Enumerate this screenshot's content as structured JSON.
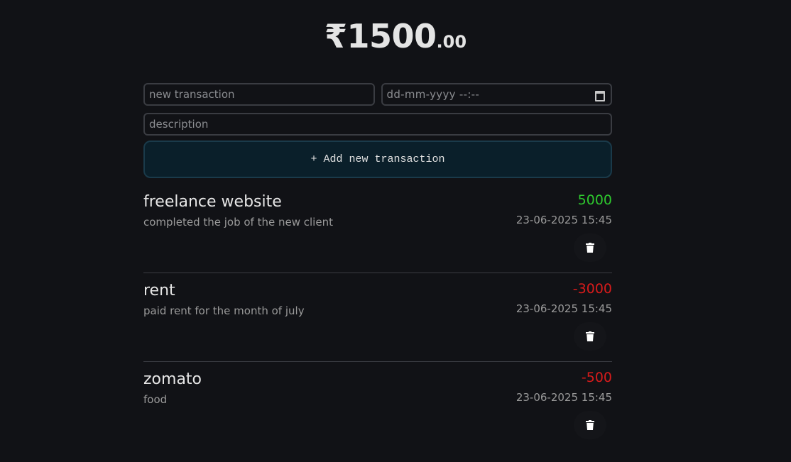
{
  "balance": {
    "main": "₹1500",
    "cents": ".00"
  },
  "form": {
    "name_placeholder": "new transaction",
    "datetime_placeholder": "dd-mm-yyyy --:--",
    "description_placeholder": "description",
    "add_label": "+ Add new transaction"
  },
  "transactions": [
    {
      "name": "freelance website",
      "description": "completed the job of the new client",
      "amount": "5000",
      "datetime": "23-06-2025 15:45",
      "sign": "positive"
    },
    {
      "name": "rent",
      "description": "paid rent for the month of july",
      "amount": "-3000",
      "datetime": "23-06-2025 15:45",
      "sign": "negative"
    },
    {
      "name": "zomato",
      "description": "food",
      "amount": "-500",
      "datetime": "23-06-2025 15:45",
      "sign": "negative"
    }
  ],
  "icons": {
    "calendar": "calendar-icon",
    "delete": "trash-icon"
  },
  "colors": {
    "background": "#111216",
    "positive": "#2ec92e",
    "negative": "#d81b1b",
    "button_bg": "#0a1f2a"
  }
}
